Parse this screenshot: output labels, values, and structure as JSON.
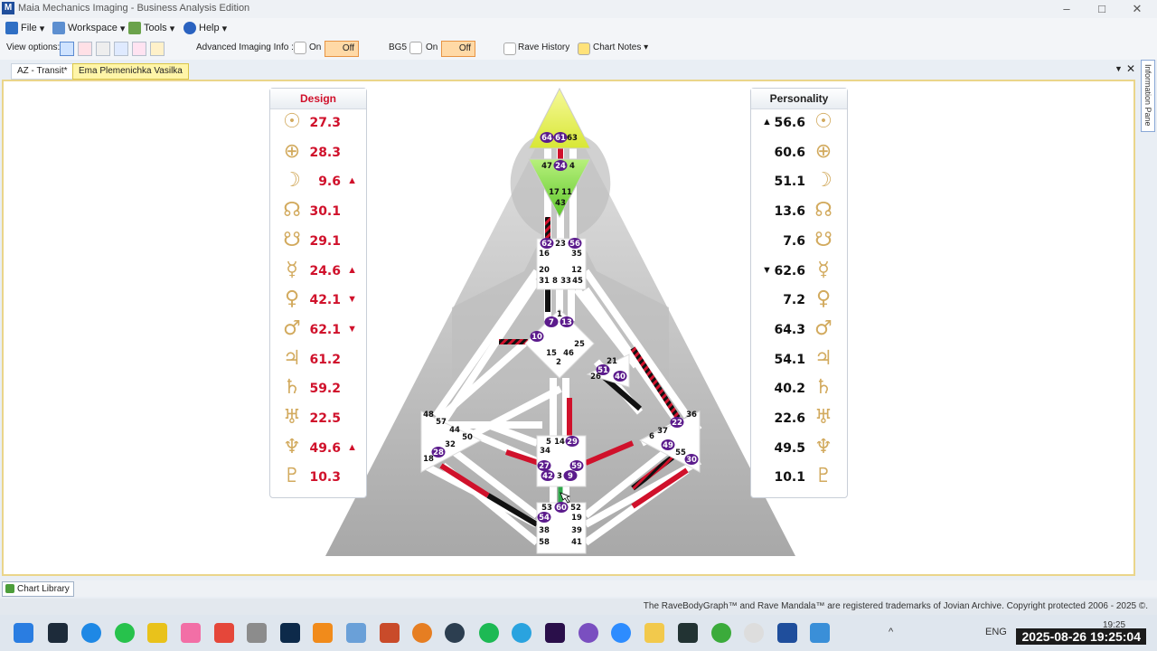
{
  "window": {
    "title": "Maia Mechanics Imaging - Business Analysis Edition",
    "icon_letter": "M"
  },
  "menu": [
    "File",
    "Workspace",
    "Tools",
    "Help"
  ],
  "toolbar": {
    "view_options_label": "View options:",
    "advanced_label": "Advanced Imaging Info :",
    "advanced_on": "On",
    "advanced_off": "Off",
    "bg5_label": "BG5",
    "bg5_on": "On",
    "bg5_off": "Off",
    "rave_history": "Rave History",
    "chart_notes": "Chart Notes"
  },
  "tabs": [
    "AZ - Transit*",
    "Ema Plemenichka Vasilka"
  ],
  "side_pane_label": "Information Pane",
  "design": {
    "title": "Design",
    "rows": [
      {
        "symbol": "☉",
        "value": "27.3",
        "arrow": ""
      },
      {
        "symbol": "⊕",
        "value": "28.3",
        "arrow": ""
      },
      {
        "symbol": "☽",
        "value": "9.6",
        "arrow": "▲"
      },
      {
        "symbol": "☊",
        "value": "30.1",
        "arrow": ""
      },
      {
        "symbol": "☋",
        "value": "29.1",
        "arrow": ""
      },
      {
        "symbol": "☿",
        "value": "24.6",
        "arrow": "▲"
      },
      {
        "symbol": "♀",
        "value": "42.1",
        "arrow": "▼"
      },
      {
        "symbol": "♂",
        "value": "62.1",
        "arrow": "▼"
      },
      {
        "symbol": "♃",
        "value": "61.2",
        "arrow": ""
      },
      {
        "symbol": "♄",
        "value": "59.2",
        "arrow": ""
      },
      {
        "symbol": "♅",
        "value": "22.5",
        "arrow": ""
      },
      {
        "symbol": "♆",
        "value": "49.6",
        "arrow": "▲"
      },
      {
        "symbol": "♇",
        "value": "10.3",
        "arrow": ""
      }
    ]
  },
  "personality": {
    "title": "Personality",
    "rows": [
      {
        "symbol": "☉",
        "value": "56.6",
        "arrow": "▲"
      },
      {
        "symbol": "⊕",
        "value": "60.6",
        "arrow": ""
      },
      {
        "symbol": "☽",
        "value": "51.1",
        "arrow": ""
      },
      {
        "symbol": "☊",
        "value": "13.6",
        "arrow": ""
      },
      {
        "symbol": "☋",
        "value": "7.6",
        "arrow": ""
      },
      {
        "symbol": "☿",
        "value": "62.6",
        "arrow": "▼"
      },
      {
        "symbol": "♀",
        "value": "7.2",
        "arrow": ""
      },
      {
        "symbol": "♂",
        "value": "64.3",
        "arrow": ""
      },
      {
        "symbol": "♃",
        "value": "54.1",
        "arrow": ""
      },
      {
        "symbol": "♄",
        "value": "40.2",
        "arrow": ""
      },
      {
        "symbol": "♅",
        "value": "22.6",
        "arrow": ""
      },
      {
        "symbol": "♆",
        "value": "49.5",
        "arrow": ""
      },
      {
        "symbol": "♇",
        "value": "10.1",
        "arrow": ""
      }
    ]
  },
  "bodygraph": {
    "gates": [
      "64",
      "61",
      "63",
      "47",
      "24",
      "4",
      "17",
      "11",
      "43",
      "62",
      "23",
      "56",
      "16",
      "35",
      "20",
      "12",
      "31",
      "8",
      "33",
      "45",
      "1",
      "7",
      "13",
      "10",
      "25",
      "46",
      "15",
      "2",
      "21",
      "51",
      "26",
      "40",
      "48",
      "57",
      "44",
      "50",
      "32",
      "28",
      "18",
      "5",
      "14",
      "29",
      "34",
      "27",
      "59",
      "42",
      "3",
      "9",
      "36",
      "22",
      "37",
      "6",
      "49",
      "55",
      "30",
      "53",
      "60",
      "52",
      "54",
      "19",
      "38",
      "39",
      "58",
      "41"
    ],
    "activated_gates": [
      "64",
      "61",
      "24",
      "62",
      "56",
      "7",
      "13",
      "10",
      "51",
      "40",
      "28",
      "29",
      "27",
      "59",
      "42",
      "9",
      "22",
      "49",
      "30",
      "60",
      "54"
    ]
  },
  "bottom": {
    "chart_library": "Chart Library"
  },
  "status": "The RaveBodyGraph™ and Rave Mandala™ are registered trademarks of Jovian Archive. Copyright protected 2006 - 2025 ©.",
  "taskbar": {
    "lang": "ENG",
    "time": "19:25",
    "timestamp": "2025-08-26 19:25:04"
  },
  "colors": {
    "design_red": "#d0112b",
    "personality_black": "#111111",
    "gold_symbol": "#d2aa5e",
    "head_yellow": "#e9f24a",
    "ajna_green": "#7fdc3a",
    "gate_purple": "#5b1b8c"
  }
}
